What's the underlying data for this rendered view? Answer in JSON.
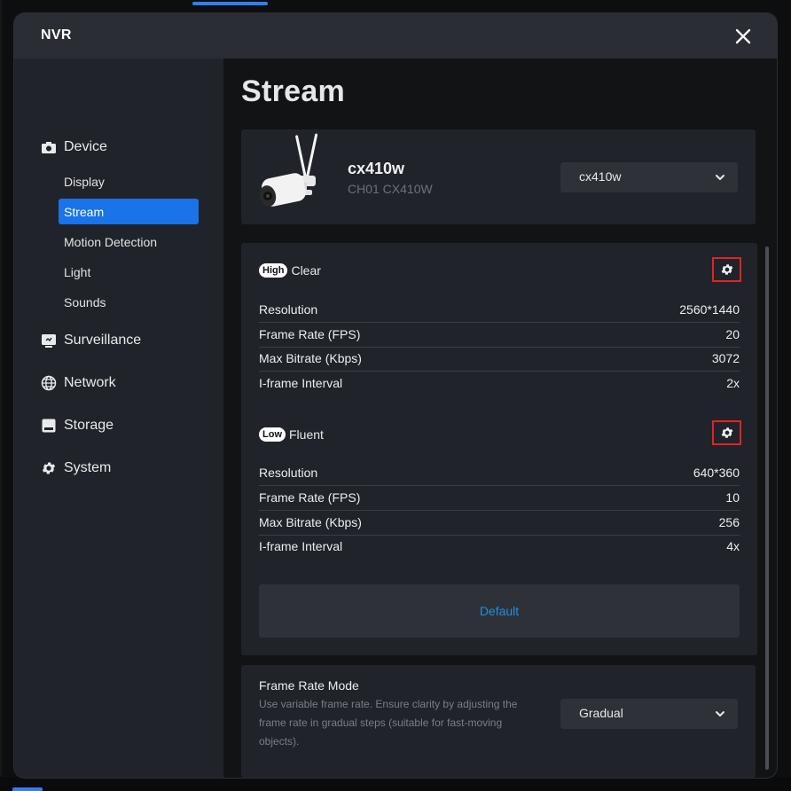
{
  "window": {
    "title": "NVR"
  },
  "sidebar": {
    "sections": [
      {
        "label": "Device",
        "icon": "camera-icon"
      },
      {
        "label": "Surveillance",
        "icon": "monitor-icon"
      },
      {
        "label": "Network",
        "icon": "globe-icon"
      },
      {
        "label": "Storage",
        "icon": "storage-icon"
      },
      {
        "label": "System",
        "icon": "gear-icon"
      }
    ],
    "device_items": [
      "Display",
      "Stream",
      "Motion Detection",
      "Light",
      "Sounds"
    ],
    "active_item": "Stream"
  },
  "page": {
    "title": "Stream"
  },
  "device": {
    "name": "cx410w",
    "subtitle": "CH01 CX410W",
    "selected": "cx410w"
  },
  "streams": [
    {
      "badge": "High",
      "name": "Clear",
      "rows": [
        {
          "label": "Resolution",
          "value": "2560*1440"
        },
        {
          "label": "Frame Rate (FPS)",
          "value": "20"
        },
        {
          "label": "Max Bitrate (Kbps)",
          "value": "3072"
        },
        {
          "label": "I-frame Interval",
          "value": "2x"
        }
      ]
    },
    {
      "badge": "Low",
      "name": "Fluent",
      "rows": [
        {
          "label": "Resolution",
          "value": "640*360"
        },
        {
          "label": "Frame Rate (FPS)",
          "value": "10"
        },
        {
          "label": "Max Bitrate (Kbps)",
          "value": "256"
        },
        {
          "label": "I-frame Interval",
          "value": "4x"
        }
      ]
    }
  ],
  "default_button": "Default",
  "frame_rate_mode": {
    "title": "Frame Rate Mode",
    "description": "Use variable frame rate. Ensure clarity by adjusting the frame rate in gradual steps (suitable for fast-moving objects).",
    "selected": "Gradual"
  },
  "colors": {
    "accent": "#1a73e8",
    "link": "#1f8fe0",
    "highlight_box": "#e02424"
  }
}
